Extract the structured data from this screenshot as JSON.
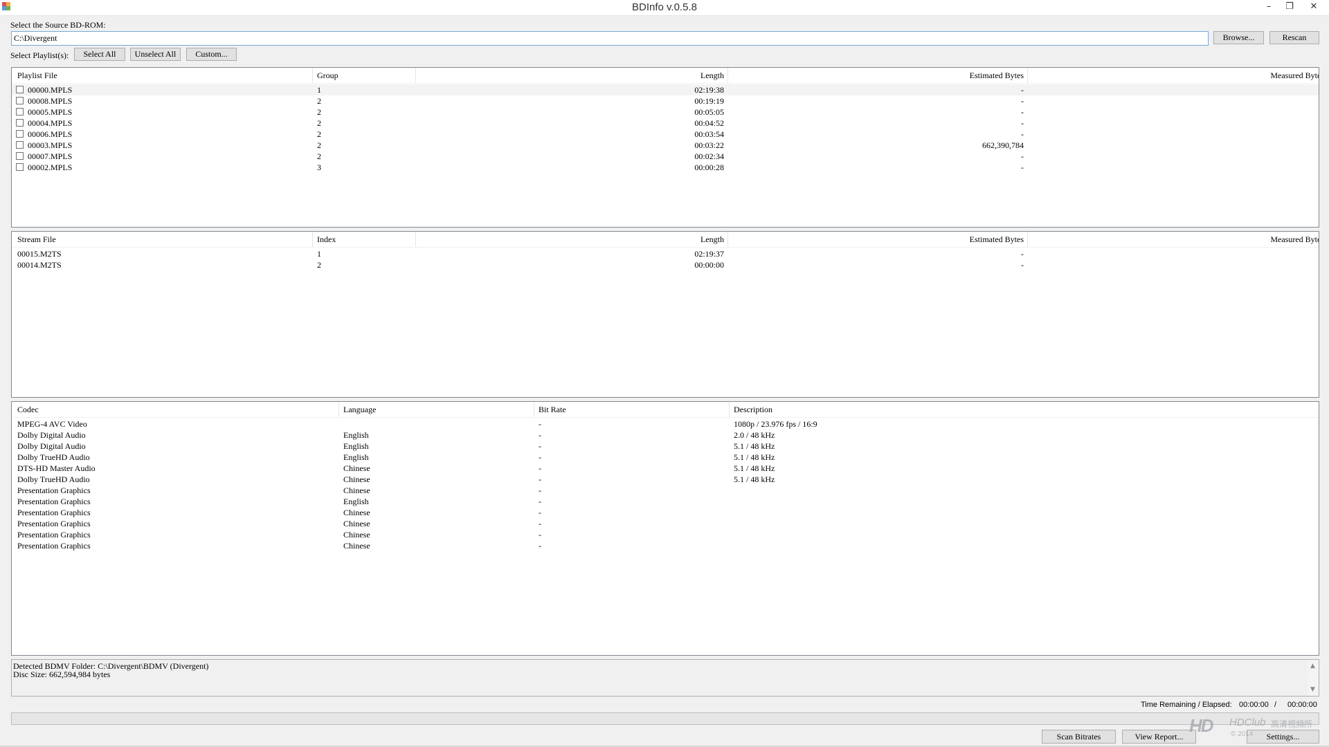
{
  "window": {
    "title": "BDInfo v.0.5.8",
    "minimize_glyph": "–",
    "restore_glyph": "❐",
    "close_glyph": "✕"
  },
  "source": {
    "label": "Select the Source BD-ROM:",
    "path": "C:\\Divergent",
    "browse_label": "Browse...",
    "rescan_label": "Rescan"
  },
  "playlist_select": {
    "label": "Select Playlist(s):",
    "select_all_label": "Select All",
    "unselect_all_label": "Unselect All",
    "custom_label": "Custom..."
  },
  "playlists": {
    "columns": [
      "Playlist File",
      "Group",
      "Length",
      "Estimated Bytes",
      "Measured Bytes"
    ],
    "rows": [
      {
        "file": "00000.MPLS",
        "group": "1",
        "length": "02:19:38",
        "estimated": "-",
        "measured": "-"
      },
      {
        "file": "00008.MPLS",
        "group": "2",
        "length": "00:19:19",
        "estimated": "-",
        "measured": "-"
      },
      {
        "file": "00005.MPLS",
        "group": "2",
        "length": "00:05:05",
        "estimated": "-",
        "measured": "-"
      },
      {
        "file": "00004.MPLS",
        "group": "2",
        "length": "00:04:52",
        "estimated": "-",
        "measured": "-"
      },
      {
        "file": "00006.MPLS",
        "group": "2",
        "length": "00:03:54",
        "estimated": "-",
        "measured": "-"
      },
      {
        "file": "00003.MPLS",
        "group": "2",
        "length": "00:03:22",
        "estimated": "662,390,784",
        "measured": "-"
      },
      {
        "file": "00007.MPLS",
        "group": "2",
        "length": "00:02:34",
        "estimated": "-",
        "measured": "-"
      },
      {
        "file": "00002.MPLS",
        "group": "3",
        "length": "00:00:28",
        "estimated": "-",
        "measured": "-"
      }
    ]
  },
  "streams": {
    "columns": [
      "Stream File",
      "Index",
      "Length",
      "Estimated Bytes",
      "Measured Bytes"
    ],
    "rows": [
      {
        "file": "00015.M2TS",
        "index": "1",
        "length": "02:19:37",
        "estimated": "-",
        "measured": "-"
      },
      {
        "file": "00014.M2TS",
        "index": "2",
        "length": "00:00:00",
        "estimated": "-",
        "measured": "-"
      }
    ]
  },
  "codecs": {
    "columns": [
      "Codec",
      "Language",
      "Bit Rate",
      "Description"
    ],
    "rows": [
      {
        "codec": "MPEG-4 AVC Video",
        "language": "",
        "bitrate": "-",
        "description": "1080p / 23.976 fps / 16:9"
      },
      {
        "codec": "Dolby Digital Audio",
        "language": "English",
        "bitrate": "-",
        "description": "2.0 / 48 kHz"
      },
      {
        "codec": "Dolby Digital Audio",
        "language": "English",
        "bitrate": "-",
        "description": "5.1 / 48 kHz"
      },
      {
        "codec": "Dolby TrueHD Audio",
        "language": "English",
        "bitrate": "-",
        "description": "5.1 / 48 kHz"
      },
      {
        "codec": "DTS-HD Master Audio",
        "language": "Chinese",
        "bitrate": "-",
        "description": "5.1 / 48 kHz"
      },
      {
        "codec": "Dolby TrueHD Audio",
        "language": "Chinese",
        "bitrate": "-",
        "description": "5.1 / 48 kHz"
      },
      {
        "codec": "Presentation Graphics",
        "language": "Chinese",
        "bitrate": "-",
        "description": ""
      },
      {
        "codec": "Presentation Graphics",
        "language": "English",
        "bitrate": "-",
        "description": ""
      },
      {
        "codec": "Presentation Graphics",
        "language": "Chinese",
        "bitrate": "-",
        "description": ""
      },
      {
        "codec": "Presentation Graphics",
        "language": "Chinese",
        "bitrate": "-",
        "description": ""
      },
      {
        "codec": "Presentation Graphics",
        "language": "Chinese",
        "bitrate": "-",
        "description": ""
      },
      {
        "codec": "Presentation Graphics",
        "language": "Chinese",
        "bitrate": "-",
        "description": ""
      }
    ]
  },
  "status": {
    "line1": "Detected BDMV Folder: C:\\Divergent\\BDMV (Divergent)",
    "line2": "Disc Size: 662,594,984 bytes"
  },
  "timer": {
    "label": "Time Remaining / Elapsed:",
    "remaining": "00:00:00",
    "separator": "/",
    "elapsed": "00:00:00"
  },
  "progress": {
    "value": 0
  },
  "footer": {
    "scan_bitrates_label": "Scan Bitrates",
    "view_report_label": "View Report...",
    "settings_label": "Settings..."
  },
  "watermark": {
    "logo": "HD",
    "brand": "HDClub",
    "cjk": "高清視頻所",
    "copyright": "© 2014"
  },
  "colors": {
    "selection_row": "#f3f3f3",
    "text_box_border": "#7aa7d9",
    "panel_border": "#828790"
  }
}
